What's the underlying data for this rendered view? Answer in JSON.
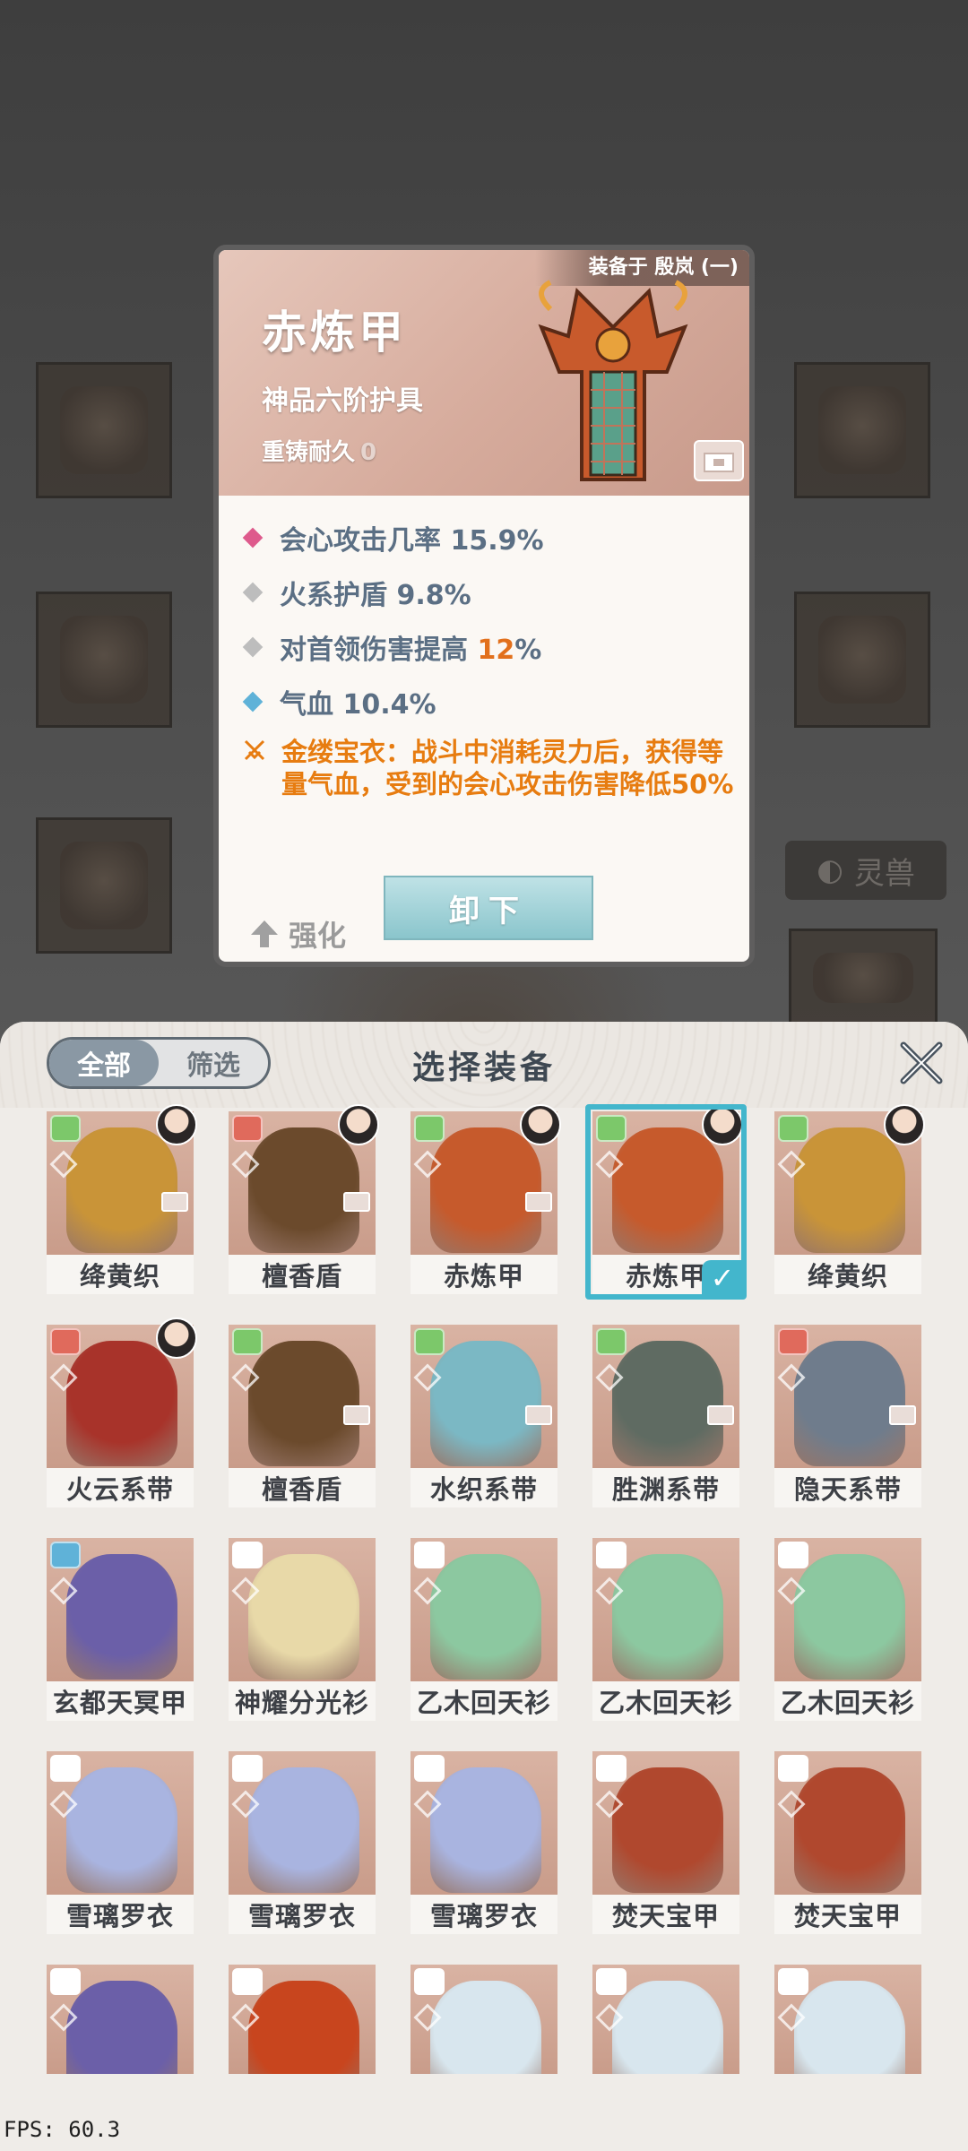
{
  "detail": {
    "equipped_on": "装备于 殷岚 (一)",
    "name": "赤炼甲",
    "grade": "神品六阶护具",
    "durability_label": "重铸耐久",
    "durability_value": "0",
    "stats": [
      {
        "text": "会心攻击几率 15.9%",
        "color": "#de5a8c"
      },
      {
        "text": "火系护盾 9.8%",
        "color": "#bdbdbd"
      },
      {
        "prefix": "对首领伤害提高 ",
        "highlight": "12",
        "suffix": "%",
        "color": "#bdbdbd"
      },
      {
        "text": "气血 10.4%",
        "color": "#5fb2d8"
      }
    ],
    "set_effect": "金缕宝衣：战斗中消耗灵力后，获得等量气血，受到的会心攻击伤害降低50%",
    "enhance_label": "强化",
    "unequip_label": "卸下"
  },
  "background": {
    "pet_tab_label": "灵兽"
  },
  "panel": {
    "tab_all": "全部",
    "tab_filter": "筛选",
    "title": "选择装备",
    "items": [
      {
        "name": "绛黄织",
        "rank": "#7cc86a",
        "art": "#c99438",
        "avatar": true,
        "lock": true
      },
      {
        "name": "檀香盾",
        "rank": "#e06a5c",
        "art": "#6b4a2c",
        "avatar": true,
        "lock": true
      },
      {
        "name": "赤炼甲",
        "rank": "#7cc86a",
        "art": "#c65a2c",
        "avatar": true,
        "lock": true
      },
      {
        "name": "赤炼甲",
        "rank": "#7cc86a",
        "art": "#c65a2c",
        "avatar": true,
        "lock": false,
        "selected": true
      },
      {
        "name": "绛黄织",
        "rank": "#7cc86a",
        "art": "#c99438",
        "avatar": true,
        "lock": false
      },
      {
        "name": "火云系带",
        "rank": "#e06a5c",
        "art": "#a8332a",
        "avatar": true,
        "lock": false
      },
      {
        "name": "檀香盾",
        "rank": "#7cc86a",
        "art": "#6b4a2c",
        "avatar": false,
        "lock": true
      },
      {
        "name": "水织系带",
        "rank": "#7cc86a",
        "art": "#7bb8c4",
        "avatar": false,
        "lock": true
      },
      {
        "name": "胜渊系带",
        "rank": "#7cc86a",
        "art": "#5f6b62",
        "avatar": false,
        "lock": true
      },
      {
        "name": "隐天系带",
        "rank": "#e06a5c",
        "art": "#6f7c8c",
        "avatar": false,
        "lock": true
      },
      {
        "name": "玄都天冥甲",
        "rank": "#5fb2d8",
        "art": "#6b5fa8",
        "avatar": false,
        "lock": false
      },
      {
        "name": "神耀分光衫",
        "rank": "#ffffff",
        "art": "#e8d9a8",
        "avatar": false,
        "lock": false
      },
      {
        "name": "乙木回天衫",
        "rank": "#ffffff",
        "art": "#8cc8a0",
        "avatar": false,
        "lock": false
      },
      {
        "name": "乙木回天衫",
        "rank": "#ffffff",
        "art": "#8cc8a0",
        "avatar": false,
        "lock": false
      },
      {
        "name": "乙木回天衫",
        "rank": "#ffffff",
        "art": "#8cc8a0",
        "avatar": false,
        "lock": false
      },
      {
        "name": "雪璃罗衣",
        "rank": "#ffffff",
        "art": "#a9b4e0",
        "avatar": false,
        "lock": false
      },
      {
        "name": "雪璃罗衣",
        "rank": "#ffffff",
        "art": "#a9b4e0",
        "avatar": false,
        "lock": false
      },
      {
        "name": "雪璃罗衣",
        "rank": "#ffffff",
        "art": "#a9b4e0",
        "avatar": false,
        "lock": false
      },
      {
        "name": "焚天宝甲",
        "rank": "#ffffff",
        "art": "#b0482e",
        "avatar": false,
        "lock": false
      },
      {
        "name": "焚天宝甲",
        "rank": "#ffffff",
        "art": "#b0482e",
        "avatar": false,
        "lock": false
      },
      {
        "name": "",
        "rank": "#ffffff",
        "art": "#6b5fa8",
        "avatar": false,
        "lock": false
      },
      {
        "name": "",
        "rank": "#ffffff",
        "art": "#c8451e",
        "avatar": false,
        "lock": false
      },
      {
        "name": "",
        "rank": "#ffffff",
        "art": "#d8e6ee",
        "avatar": false,
        "lock": false
      },
      {
        "name": "",
        "rank": "#ffffff",
        "art": "#d8e6ee",
        "avatar": false,
        "lock": false
      },
      {
        "name": "",
        "rank": "#ffffff",
        "art": "#d8e6ee",
        "avatar": false,
        "lock": false
      }
    ]
  },
  "fps_text": "FPS: 60.3"
}
